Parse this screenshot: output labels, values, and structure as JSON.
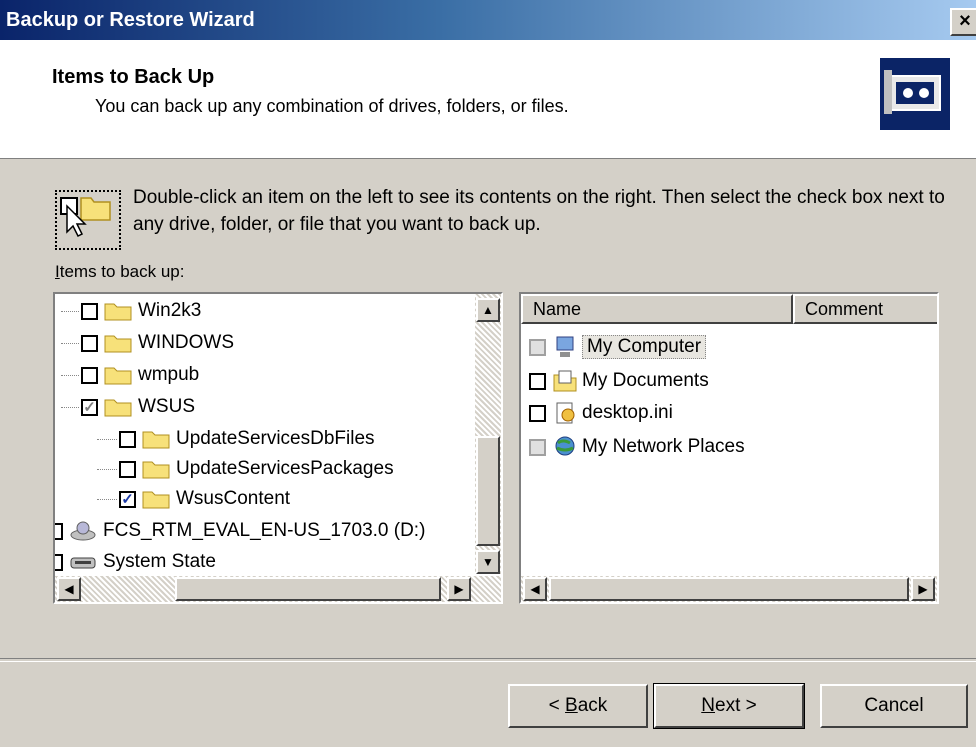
{
  "window": {
    "title": "Backup or Restore Wizard",
    "close_label": "×"
  },
  "header": {
    "title": "Items to Back Up",
    "subtitle": "You can back up any combination of drives, folders, or files.",
    "icon": "backup-wizard-icon"
  },
  "instructions": {
    "text": "Double-click an item on the left to see its contents on the right. Then select the check box next to any drive, folder, or file that you want to back up.",
    "icon": "select-item-icon"
  },
  "tree": {
    "label_prefix": "I",
    "label_rest": "tems to back up:",
    "items": [
      {
        "label": "Win2k3",
        "checked": ""
      },
      {
        "label": "WINDOWS",
        "checked": ""
      },
      {
        "label": "wmpub",
        "checked": ""
      },
      {
        "label": "WSUS",
        "checked": "✓"
      },
      {
        "label": "UpdateServicesDbFiles",
        "checked": ""
      },
      {
        "label": "UpdateServicesPackages",
        "checked": ""
      },
      {
        "label": "WsusContent",
        "checked": "✓"
      },
      {
        "label": "FCS_RTM_EVAL_EN-US_1703.0 (D:)",
        "checked": ""
      },
      {
        "label": "System State",
        "checked": ""
      }
    ]
  },
  "list": {
    "columns": [
      "Name",
      "Comment"
    ],
    "items": [
      {
        "label": "My Computer",
        "icon": "computer-icon"
      },
      {
        "label": "My Documents",
        "icon": "documents-icon"
      },
      {
        "label": "desktop.ini",
        "icon": "ini-file-icon"
      },
      {
        "label": "My Network Places",
        "icon": "network-icon"
      }
    ]
  },
  "buttons": {
    "back_prefix": "< ",
    "back_u": "B",
    "back_rest": "ack",
    "next_u": "N",
    "next_rest": "ext >",
    "cancel": "Cancel"
  },
  "colors": {
    "title_start": "#0a246a",
    "title_end": "#a6caf0",
    "header_icon_bg": "#0b2466"
  }
}
